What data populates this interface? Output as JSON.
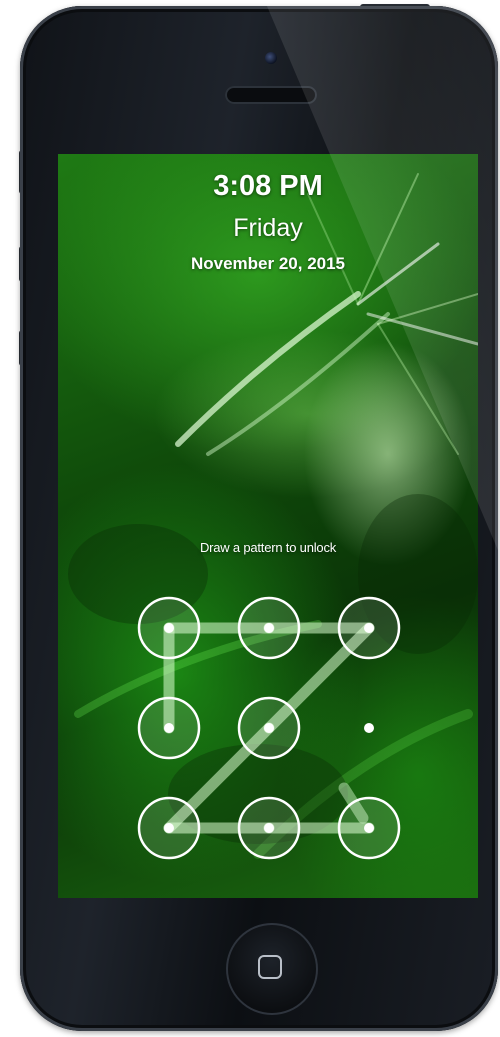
{
  "lockscreen": {
    "time": "3:08 PM",
    "day": "Friday",
    "date": "November 20, 2015",
    "unlock_hint": "Draw a pattern to unlock"
  },
  "pattern": {
    "grid_size": 3,
    "selected_nodes": [
      0,
      1,
      2,
      3,
      4,
      6,
      7,
      8
    ],
    "path_sequence": [
      3,
      0,
      1,
      2,
      4,
      6,
      7,
      8
    ],
    "unselected_nodes": [
      5
    ]
  },
  "colors": {
    "wallpaper_primary": "#1f7a14",
    "text": "#ffffff",
    "phone_body": "#14181e"
  },
  "icons": {
    "home_button": "rounded-square-icon",
    "camera": "camera-icon",
    "speaker": "speaker-grille"
  }
}
